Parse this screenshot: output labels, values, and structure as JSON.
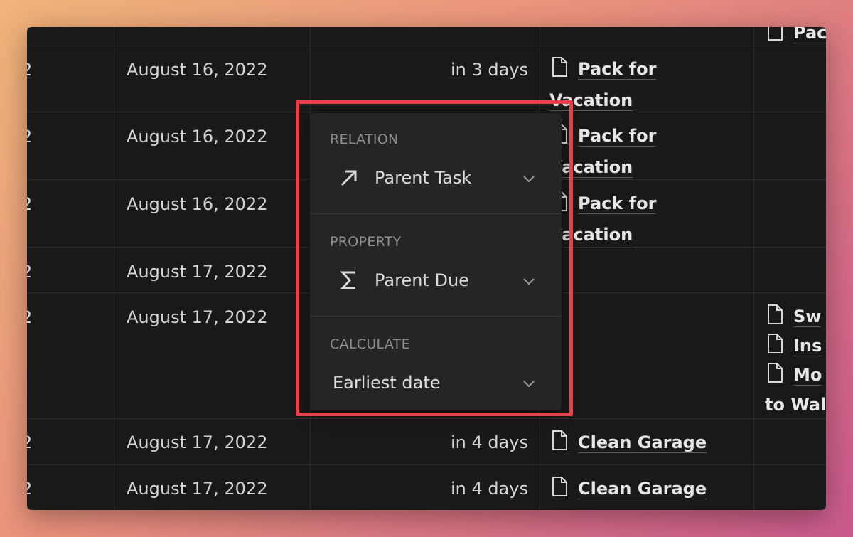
{
  "rows": [
    {
      "date": "",
      "relative": "",
      "task": "Pac"
    },
    {
      "date": "August 16, 2022",
      "relative": "in 3 days",
      "task_line1": "Pack for",
      "task_line2": "Vacation"
    },
    {
      "date": "August 16, 2022",
      "relative": "",
      "task_line1": "Pack for",
      "task_line2": "Vacation"
    },
    {
      "date": "August 16, 2022",
      "relative": "",
      "task_line1": "Pack for",
      "task_line2": "Vacation"
    },
    {
      "date": "August 17, 2022",
      "relative": ""
    },
    {
      "date": "August 17, 2022",
      "relative": "",
      "subtasks": [
        "Sw",
        "Ins",
        "Mo",
        "to Wall"
      ]
    },
    {
      "date": "August 17, 2022",
      "relative": "in 4 days",
      "task": "Clean Garage"
    },
    {
      "date": "August 17, 2022",
      "relative": "in 4 days",
      "task": "Clean Garage"
    }
  ],
  "cut_marker": "2",
  "popup": {
    "relation": {
      "label": "RELATION",
      "value": "Parent Task",
      "icon": "arrow-up-right-icon"
    },
    "property": {
      "label": "PROPERTY",
      "value": "Parent Due",
      "icon": "sigma-icon"
    },
    "calculate": {
      "label": "CALCULATE",
      "value": "Earliest date"
    }
  },
  "colors": {
    "highlight": "#e8414a",
    "panel": "#252525",
    "background": "#191919"
  }
}
